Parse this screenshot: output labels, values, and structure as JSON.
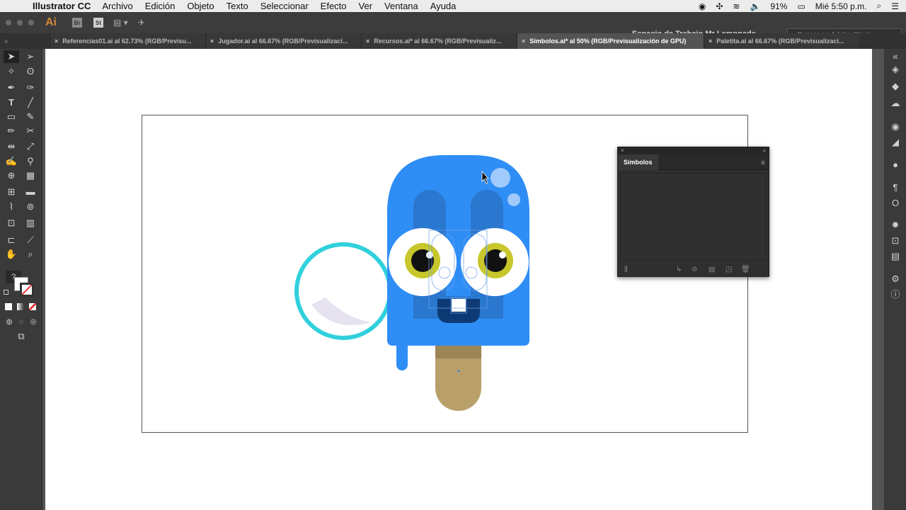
{
  "menubar": {
    "app": "Illustrator CC",
    "items": [
      "Archivo",
      "Edición",
      "Objeto",
      "Texto",
      "Seleccionar",
      "Efecto",
      "Ver",
      "Ventana",
      "Ayuda"
    ],
    "battery": "91%",
    "clock": "Mié 5:50 p.m."
  },
  "appbar": {
    "logo": "Ai",
    "bridge": "Br",
    "stock_btn": "St",
    "workspace": "Espacio de Trabajo Mr Lemonade",
    "search_placeholder": "Buscar en Adobe Stock"
  },
  "tabs": [
    {
      "label": "Referencias01.ai al 62.73% (RGB/Previsu...",
      "active": false
    },
    {
      "label": "Jugador.ai al 66.67% (RGB/Previsualizaci...",
      "active": false
    },
    {
      "label": "Recursos.ai* al 66.67% (RGB/Previsualiz...",
      "active": false
    },
    {
      "label": "Símbolos.ai* al 50% (RGB/Previsualización de GPU)",
      "active": true
    },
    {
      "label": "Paletita.ai al 66.67% (RGB/Previsualizaci...",
      "active": false
    }
  ],
  "panel": {
    "title": "Símbolos"
  },
  "colors": {
    "popsicle": "#2f8ef5",
    "stick": "#b9a06a",
    "ring": "#30d0dc",
    "iris": "#c7c62b",
    "panel": "#2f2f2f"
  }
}
